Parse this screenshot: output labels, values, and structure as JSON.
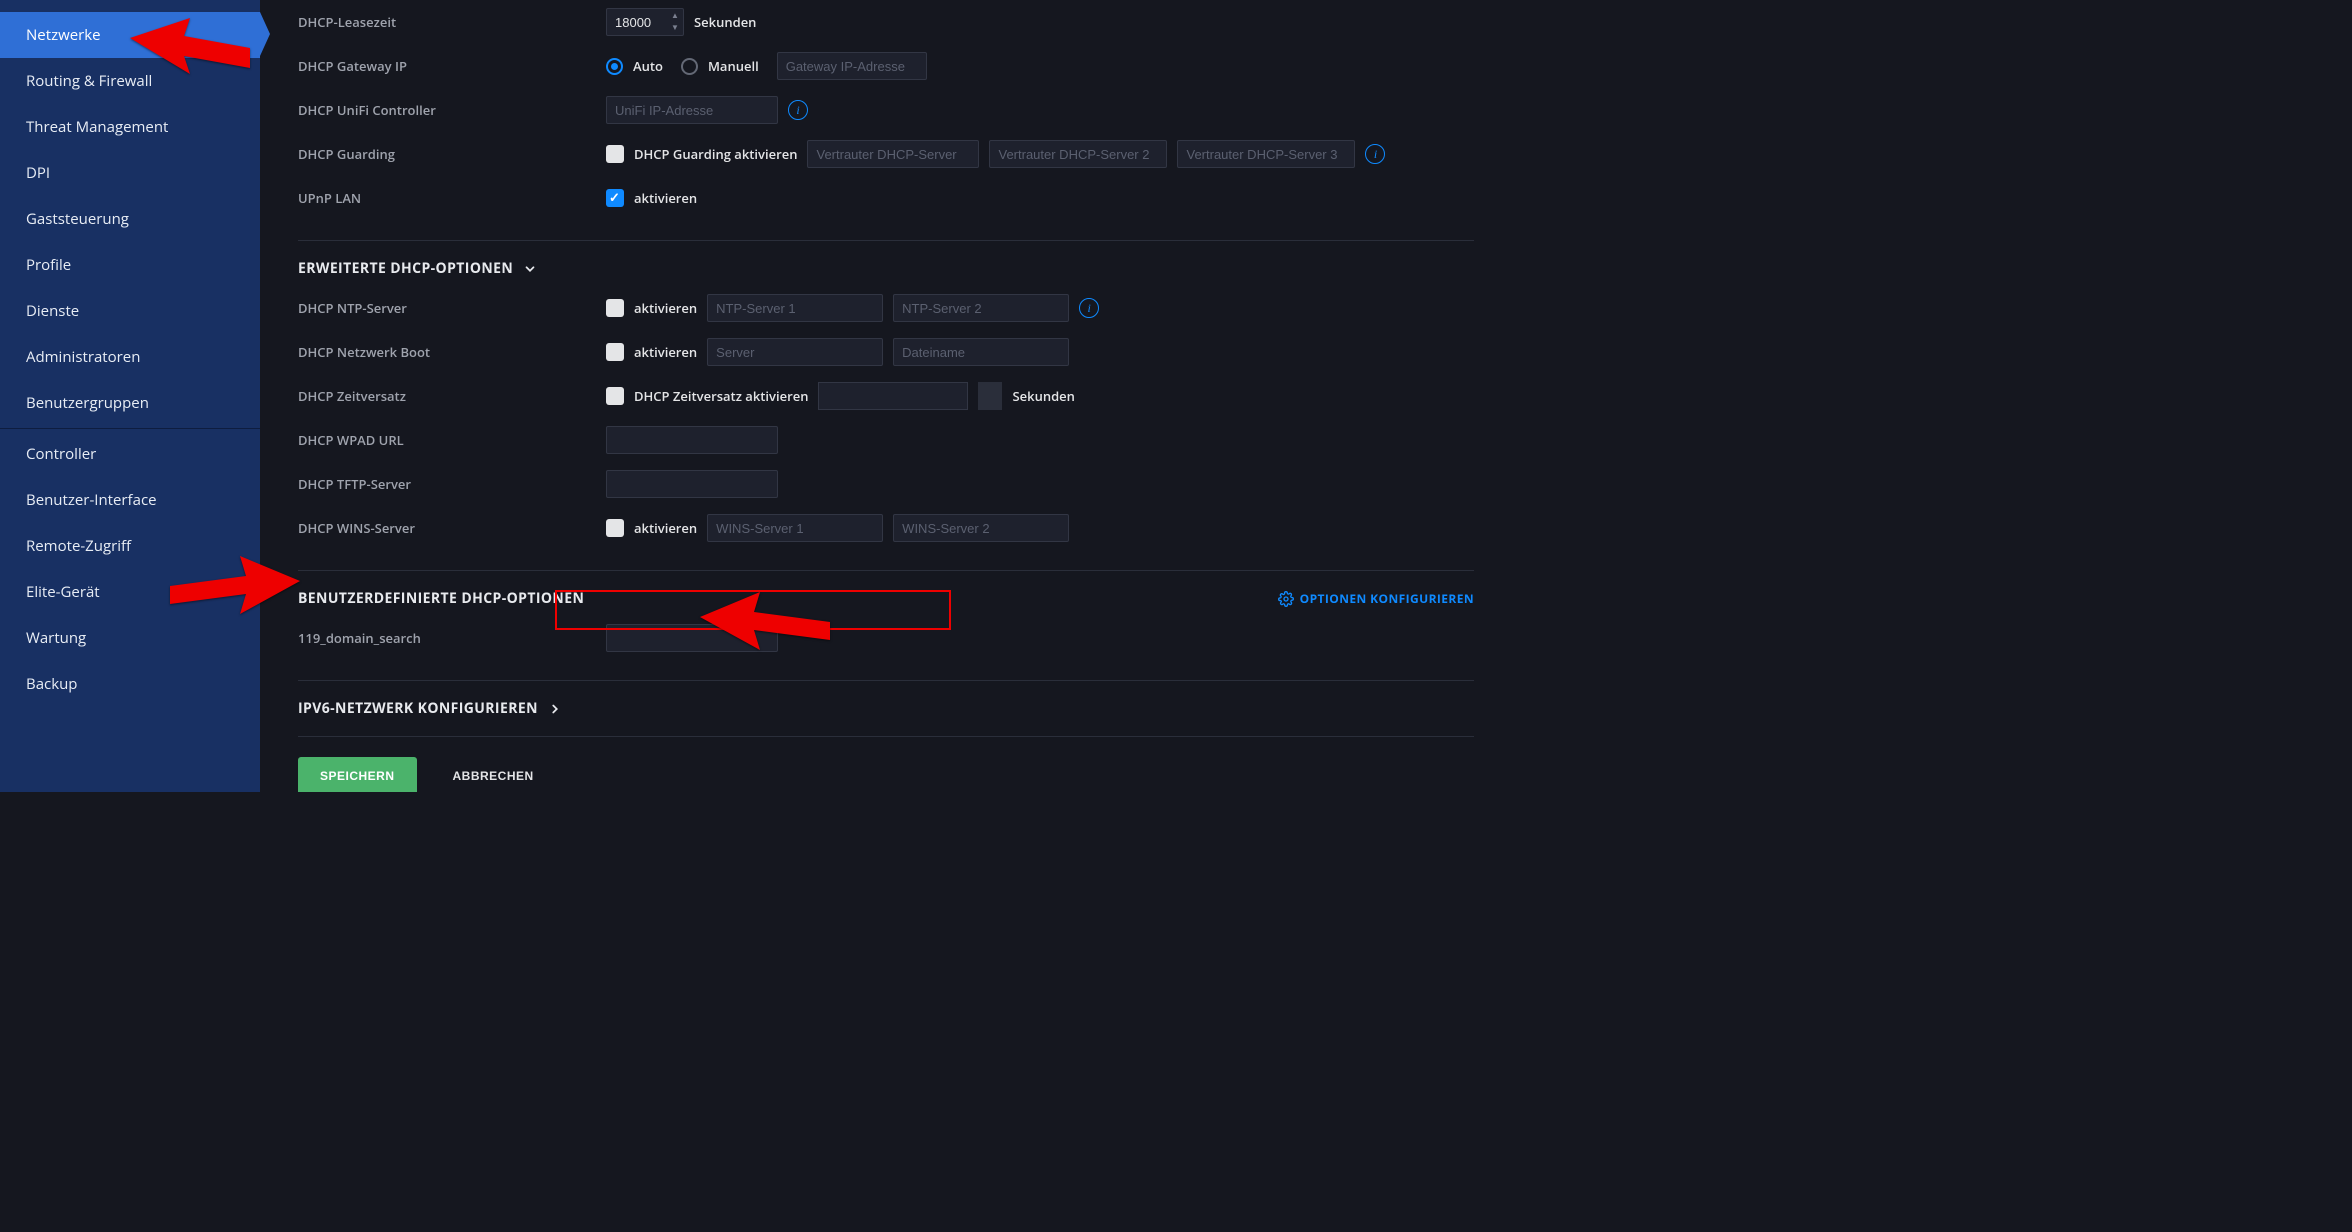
{
  "sidebar": {
    "items": [
      {
        "label": "Netzwerke",
        "active": true
      },
      {
        "label": "Routing & Firewall"
      },
      {
        "label": "Threat Management"
      },
      {
        "label": "DPI"
      },
      {
        "label": "Gaststeuerung"
      },
      {
        "label": "Profile"
      },
      {
        "label": "Dienste"
      },
      {
        "label": "Administratoren"
      },
      {
        "label": "Benutzergruppen"
      },
      {
        "sep": true
      },
      {
        "label": "Controller"
      },
      {
        "label": "Benutzer-Interface"
      },
      {
        "label": "Remote-Zugriff"
      },
      {
        "label": "Elite-Gerät"
      },
      {
        "label": "Wartung"
      },
      {
        "label": "Backup"
      }
    ]
  },
  "form": {
    "dhcp_lease": {
      "label": "DHCP-Leasezeit",
      "value": "18000",
      "unit": "Sekunden"
    },
    "dhcp_gateway": {
      "label": "DHCP Gateway IP",
      "auto": "Auto",
      "manual": "Manuell",
      "placeholder": "Gateway IP-Adresse"
    },
    "dhcp_unifi": {
      "label": "DHCP UniFi Controller",
      "placeholder": "UniFi IP-Adresse"
    },
    "dhcp_guarding": {
      "label": "DHCP Guarding",
      "chk": "DHCP Guarding aktivieren",
      "p1": "Vertrauter DHCP-Server",
      "p2": "Vertrauter DHCP-Server 2",
      "p3": "Vertrauter DHCP-Server 3"
    },
    "upnp": {
      "label": "UPnP LAN",
      "chk": "aktivieren"
    },
    "ext_header": "ERWEITERTE DHCP-OPTIONEN",
    "dhcp_ntp": {
      "label": "DHCP NTP-Server",
      "chk": "aktivieren",
      "p1": "NTP-Server 1",
      "p2": "NTP-Server 2"
    },
    "dhcp_netboot": {
      "label": "DHCP Netzwerk Boot",
      "chk": "aktivieren",
      "p1": "Server",
      "p2": "Dateiname"
    },
    "dhcp_tz": {
      "label": "DHCP Zeitversatz",
      "chk": "DHCP Zeitversatz aktivieren",
      "unit": "Sekunden"
    },
    "dhcp_wpad": {
      "label": "DHCP WPAD URL"
    },
    "dhcp_tftp": {
      "label": "DHCP TFTP-Server"
    },
    "dhcp_wins": {
      "label": "DHCP WINS-Server",
      "chk": "aktivieren",
      "p1": "WINS-Server 1",
      "p2": "WINS-Server 2"
    },
    "custom_header": "BENUTZERDEFINIERTE DHCP-OPTIONEN",
    "configure_options": "OPTIONEN KONFIGURIEREN",
    "custom_opt": {
      "label": "119_domain_search"
    },
    "ipv6_header": "IPV6-NETZWERK KONFIGURIEREN",
    "save": "SPEICHERN",
    "cancel": "ABBRECHEN"
  }
}
